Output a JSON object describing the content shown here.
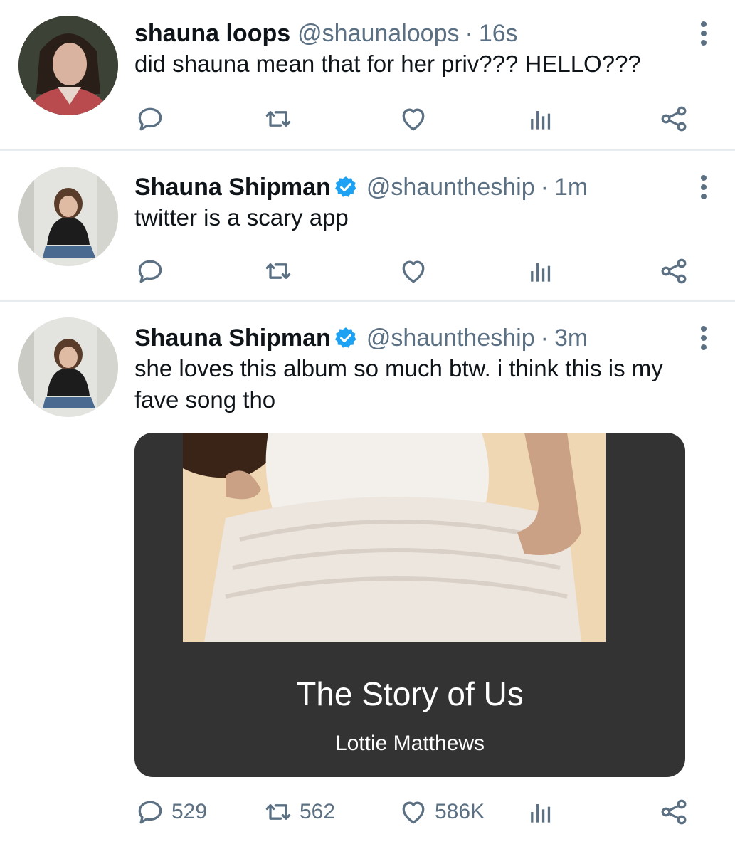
{
  "tweets": [
    {
      "name": "shauna loops",
      "verified": false,
      "handle": "@shaunaloops",
      "separator": "·",
      "time": "16s",
      "text": "did shauna mean that for her priv??? HELLO???",
      "counts": {
        "replies": "",
        "retweets": "",
        "likes": ""
      }
    },
    {
      "name": "Shauna Shipman",
      "verified": true,
      "handle": "@shauntheship",
      "separator": "·",
      "time": "1m",
      "text": "twitter is a scary app",
      "counts": {
        "replies": "",
        "retweets": "",
        "likes": ""
      }
    },
    {
      "name": "Shauna Shipman",
      "verified": true,
      "handle": "@shauntheship",
      "separator": "·",
      "time": "3m",
      "text": "she loves this album so much btw. i think this is my fave song tho",
      "card": {
        "title": "The Story of Us",
        "artist": "Lottie Matthews"
      },
      "counts": {
        "replies": "529",
        "retweets": "562",
        "likes": "586K"
      }
    }
  ],
  "icons": {
    "reply": "reply-icon",
    "retweet": "retweet-icon",
    "like": "heart-icon",
    "stats": "stats-icon",
    "share": "share-icon",
    "more": "more-vertical-icon",
    "verified": "verified-badge-icon"
  },
  "colors": {
    "icon_gray": "#5b7083",
    "verified_blue": "#1da1f2",
    "card_bg": "#333333",
    "divider": "#e6ecf0"
  }
}
